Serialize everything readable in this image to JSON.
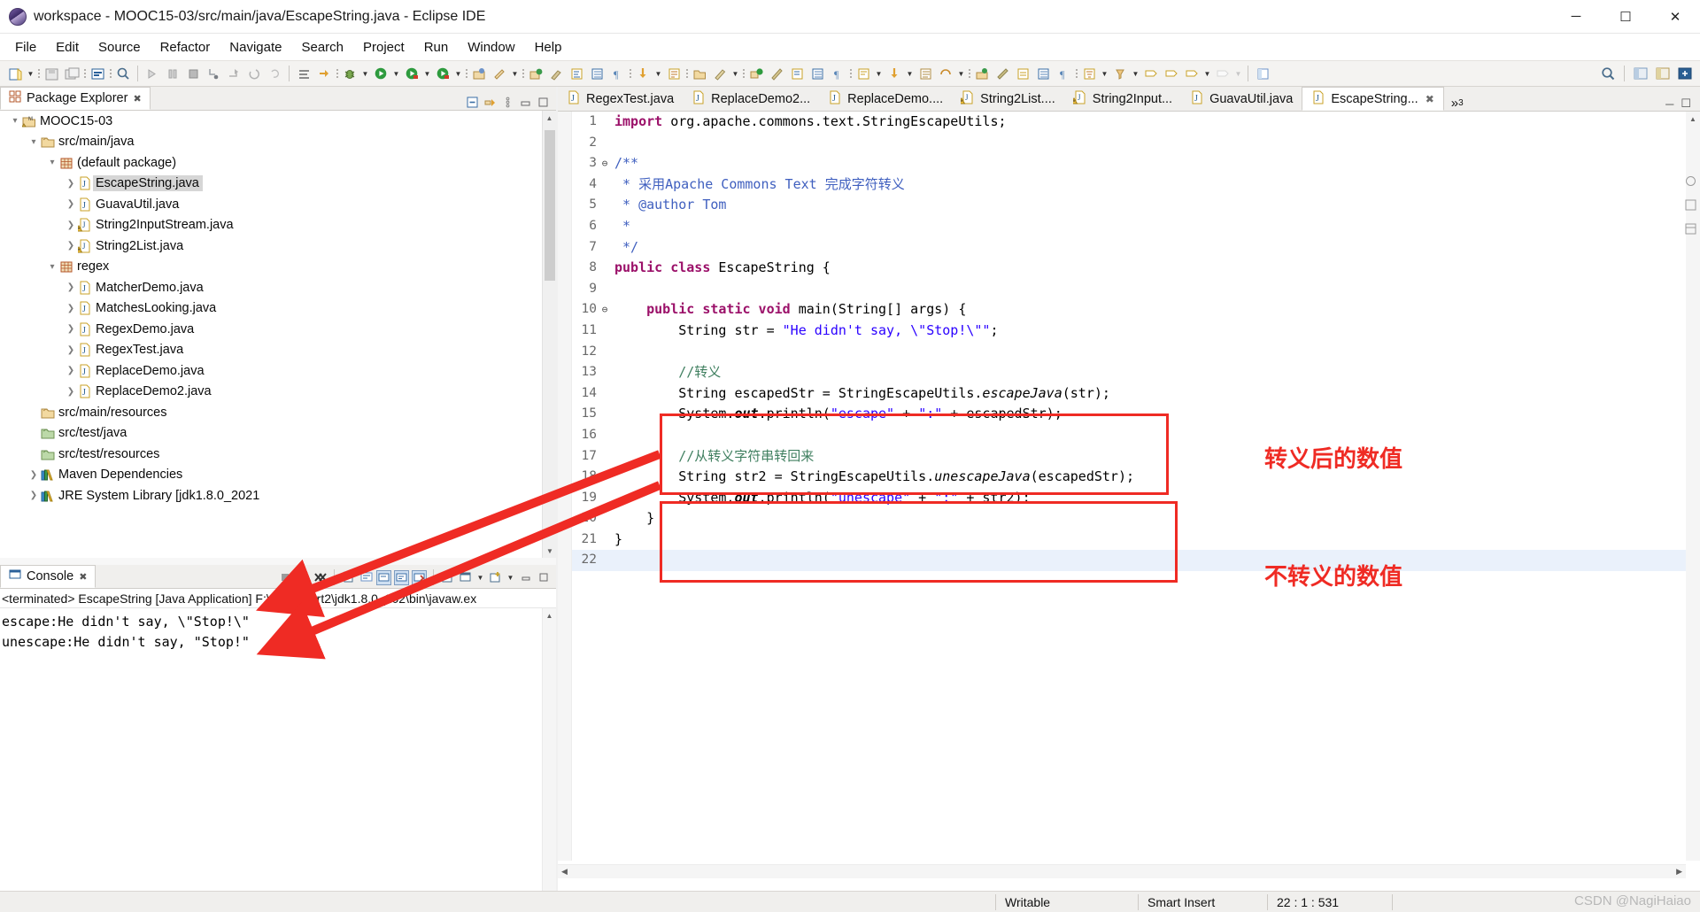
{
  "window": {
    "title": "workspace - MOOC15-03/src/main/java/EscapeString.java - Eclipse IDE",
    "app_icon": "eclipse-logo-icon",
    "minimize_label": "─",
    "maximize_label": "☐",
    "close_label": "✕"
  },
  "menubar": {
    "items": [
      "File",
      "Edit",
      "Source",
      "Refactor",
      "Navigate",
      "Search",
      "Project",
      "Run",
      "Window",
      "Help"
    ]
  },
  "package_explorer": {
    "tab_label": "Package Explorer",
    "tab_close": "✖",
    "tree": [
      {
        "label": "MOOC15-03",
        "indent": 0,
        "expander": "v",
        "icon": "java-project-icon",
        "selected": false
      },
      {
        "label": "src/main/java",
        "indent": 1,
        "expander": "v",
        "icon": "source-folder-icon",
        "selected": false
      },
      {
        "label": "(default package)",
        "indent": 2,
        "expander": "v",
        "icon": "package-icon",
        "selected": false
      },
      {
        "label": "EscapeString.java",
        "indent": 3,
        "expander": ">",
        "icon": "java-file-icon",
        "selected": true
      },
      {
        "label": "GuavaUtil.java",
        "indent": 3,
        "expander": ">",
        "icon": "java-file-icon",
        "selected": false
      },
      {
        "label": "String2InputStream.java",
        "indent": 3,
        "expander": ">",
        "icon": "java-file-warning-icon",
        "selected": false
      },
      {
        "label": "String2List.java",
        "indent": 3,
        "expander": ">",
        "icon": "java-file-warning-icon",
        "selected": false
      },
      {
        "label": "regex",
        "indent": 2,
        "expander": "v",
        "icon": "package-icon",
        "selected": false
      },
      {
        "label": "MatcherDemo.java",
        "indent": 3,
        "expander": ">",
        "icon": "java-file-icon",
        "selected": false
      },
      {
        "label": "MatchesLooking.java",
        "indent": 3,
        "expander": ">",
        "icon": "java-file-icon",
        "selected": false
      },
      {
        "label": "RegexDemo.java",
        "indent": 3,
        "expander": ">",
        "icon": "java-file-icon",
        "selected": false
      },
      {
        "label": "RegexTest.java",
        "indent": 3,
        "expander": ">",
        "icon": "java-file-icon",
        "selected": false
      },
      {
        "label": "ReplaceDemo.java",
        "indent": 3,
        "expander": ">",
        "icon": "java-file-icon",
        "selected": false
      },
      {
        "label": "ReplaceDemo2.java",
        "indent": 3,
        "expander": ">",
        "icon": "java-file-icon",
        "selected": false
      },
      {
        "label": "src/main/resources",
        "indent": 1,
        "expander": "",
        "icon": "source-folder-icon",
        "selected": false
      },
      {
        "label": "src/test/java",
        "indent": 1,
        "expander": "",
        "icon": "source-folder-green-icon",
        "selected": false
      },
      {
        "label": "src/test/resources",
        "indent": 1,
        "expander": "",
        "icon": "source-folder-green-icon",
        "selected": false
      },
      {
        "label": "Maven Dependencies",
        "indent": 1,
        "expander": ">",
        "icon": "library-icon",
        "selected": false
      },
      {
        "label": "JRE System Library [jdk1.8.0_2021",
        "indent": 1,
        "expander": ">",
        "icon": "library-icon",
        "selected": false
      }
    ]
  },
  "console": {
    "tab_label": "Console",
    "tab_close": "✖",
    "launch_line": "<terminated> EscapeString [Java Application] F:\\Java_part2\\jdk1.8.0_202\\bin\\javaw.ex",
    "output_lines": [
      "escape:He didn't say, \\\"Stop!\\\"",
      "unescape:He didn't say, \"Stop!\""
    ],
    "toolbar_icons": [
      "terminate-icon",
      "remove-launch-icon",
      "remove-all-launches-icon",
      "open-console-icon",
      "word-wrap-icon",
      "scroll-lock-icon",
      "pin-console-icon",
      "display-selected-console-icon",
      "new-console-view-icon",
      "minimize-icon",
      "maximize-icon"
    ]
  },
  "editor": {
    "tabs": [
      {
        "label": "RegexTest.java",
        "icon": "java-file-icon",
        "active": false
      },
      {
        "label": "ReplaceDemo2...",
        "icon": "java-file-icon",
        "active": false
      },
      {
        "label": "ReplaceDemo....",
        "icon": "java-file-icon",
        "active": false
      },
      {
        "label": "String2List....",
        "icon": "java-file-warning-icon",
        "active": false
      },
      {
        "label": "String2Input...",
        "icon": "java-file-warning-icon",
        "active": false
      },
      {
        "label": "GuavaUtil.java",
        "icon": "java-file-icon",
        "active": false
      },
      {
        "label": "EscapeString...",
        "icon": "java-file-icon",
        "active": true
      }
    ],
    "overflow_label": "»",
    "overflow_count": "3",
    "minimize_label": "─",
    "maximize_label": "☐",
    "code_lines": [
      {
        "n": "1",
        "fold": "",
        "html": "<span class=\"kw\">import</span> org.apache.commons.text.StringEscapeUtils;"
      },
      {
        "n": "2",
        "fold": "",
        "html": ""
      },
      {
        "n": "3",
        "fold": "⊖",
        "html": "<span class=\"jdoc\">/**</span>"
      },
      {
        "n": "4",
        "fold": "",
        "html": "<span class=\"jdoc\"> * 采用Apache Commons Text 完成字符转义</span>"
      },
      {
        "n": "5",
        "fold": "",
        "html": "<span class=\"jdoc\"> * @author Tom</span>"
      },
      {
        "n": "6",
        "fold": "",
        "html": "<span class=\"jdoc\"> *</span>"
      },
      {
        "n": "7",
        "fold": "",
        "html": "<span class=\"jdoc\"> */</span>"
      },
      {
        "n": "8",
        "fold": "",
        "html": "<span class=\"kw\">public class</span> EscapeString {"
      },
      {
        "n": "9",
        "fold": "",
        "html": ""
      },
      {
        "n": "10",
        "fold": "⊖",
        "html": "    <span class=\"kw\">public static void</span> main(String[] args) {"
      },
      {
        "n": "11",
        "fold": "",
        "html": "        String str = <span class=\"str\">\"He didn't say, \\\"Stop!\\\"\"</span>;"
      },
      {
        "n": "12",
        "fold": "",
        "html": ""
      },
      {
        "n": "13",
        "fold": "",
        "html": "        <span class=\"cmt\">//转义</span>"
      },
      {
        "n": "14",
        "fold": "",
        "html": "        String escapedStr = StringEscapeUtils.<span class=\"stc\">escapeJava</span>(str);"
      },
      {
        "n": "15",
        "fold": "",
        "html": "        System.<span class=\"stcb\">out</span>.println(<span class=\"str\">\"escape\"</span> + <span class=\"str\">\":\"</span> + escapedStr);"
      },
      {
        "n": "16",
        "fold": "",
        "html": ""
      },
      {
        "n": "17",
        "fold": "",
        "html": "        <span class=\"cmt\">//从转义字符串转回来</span>"
      },
      {
        "n": "18",
        "fold": "",
        "html": "        String str2 = StringEscapeUtils.<span class=\"stc\">unescapeJava</span>(escapedStr);"
      },
      {
        "n": "19",
        "fold": "",
        "html": "        System.<span class=\"stcb\">out</span>.println(<span class=\"str\">\"unescape\"</span> + <span class=\"str\">\":\"</span> + str2);"
      },
      {
        "n": "20",
        "fold": "",
        "html": "    }"
      },
      {
        "n": "21",
        "fold": "",
        "html": "}"
      },
      {
        "n": "22",
        "fold": "",
        "html": "",
        "current": true
      }
    ]
  },
  "annotations": {
    "accent_color": "#ef2b24",
    "label_escaped": "转义后的数值",
    "label_unescaped": "不转义的数值"
  },
  "statusbar": {
    "writable": "Writable",
    "insert_mode": "Smart Insert",
    "position": "22 : 1 : 531"
  },
  "watermark": "CSDN @NagiHaiao"
}
